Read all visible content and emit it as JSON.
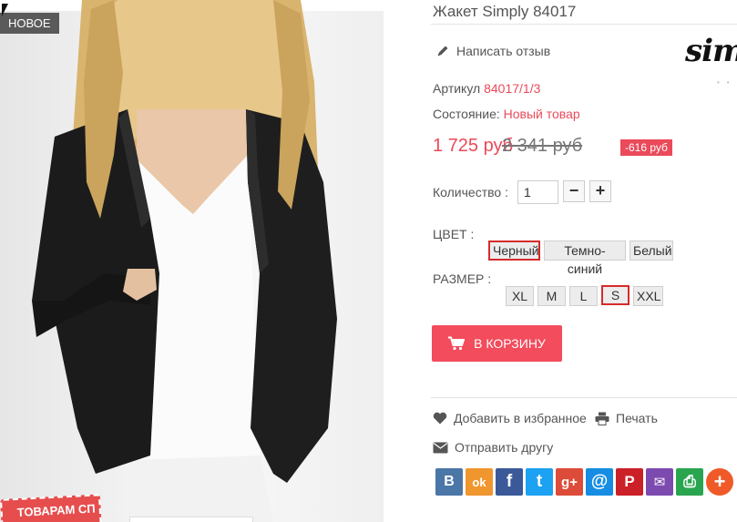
{
  "photo": {
    "badge": "НОВОЕ",
    "promo_text": "ТОВАРАМ СП"
  },
  "product": {
    "title": "Жакет Simply 84017",
    "review_link": "Написать отзыв",
    "brand_logo_text": "simp",
    "article_label": "Артикул",
    "article_value": "84017/1/3",
    "condition_label": "Состояние:",
    "condition_value": "Новый товар",
    "price": "1 725 руб",
    "old_price": "2 341 руб",
    "discount": "-616 руб",
    "quantity_label": "Количество :",
    "quantity_value": "1",
    "minus_label": "−",
    "plus_label": "+",
    "color_label": "ЦВЕТ :",
    "colors": [
      "Черный",
      "Темно-синий",
      "Белый"
    ],
    "selected_color": "Черный",
    "size_label": "РАЗМЕР :",
    "sizes": [
      "XL",
      "M",
      "L",
      "S",
      "XXL"
    ],
    "selected_size": "S",
    "cart_button": "В КОРЗИНУ",
    "favorite": "Добавить в избранное",
    "print": "Печать",
    "send": "Отправить другу"
  },
  "social": [
    {
      "name": "vk",
      "glyph": "В",
      "color": "#4a76a8"
    },
    {
      "name": "odnoklassniki",
      "glyph": "ok",
      "color": "#f0962f"
    },
    {
      "name": "facebook",
      "glyph": "f",
      "color": "#3b5998"
    },
    {
      "name": "twitter",
      "glyph": "t",
      "color": "#1da1f2"
    },
    {
      "name": "google-plus",
      "glyph": "g+",
      "color": "#dd4b39"
    },
    {
      "name": "mail",
      "glyph": "@",
      "color": "#168de2"
    },
    {
      "name": "pinterest",
      "glyph": "P",
      "color": "#cb2027"
    },
    {
      "name": "email",
      "glyph": "✉",
      "color": "#7d4ab0"
    },
    {
      "name": "print",
      "glyph": "⎙",
      "color": "#2aa54f"
    },
    {
      "name": "more",
      "glyph": "+",
      "color": "#f05a28"
    }
  ],
  "colors": {
    "accent": "#ea4a5a",
    "cart": "#f24c5d",
    "selected_border": "#d62b2b"
  }
}
